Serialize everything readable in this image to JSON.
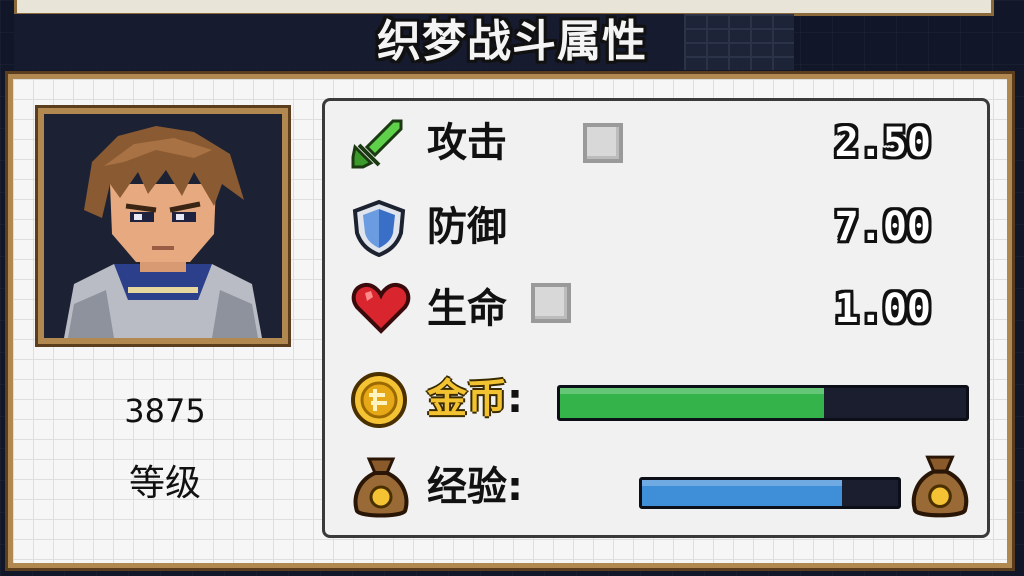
{
  "title": "织梦战斗属性",
  "portrait": {
    "icon": "hero-portrait"
  },
  "level": {
    "value": "3875",
    "label": "等级"
  },
  "stats": [
    {
      "key": "attack",
      "label": "攻击",
      "value": "2.50",
      "icon": "sword-icon",
      "has_checkbox": true
    },
    {
      "key": "defense",
      "label": "防御",
      "value": "7.00",
      "icon": "shield-icon",
      "has_checkbox": false
    },
    {
      "key": "health",
      "label": "生命",
      "value": "1.00",
      "icon": "heart-icon",
      "has_checkbox": true
    }
  ],
  "bars": {
    "gold": {
      "label": "金币",
      "separator": ":",
      "fill_fraction": 0.65,
      "color": "#33b34a",
      "icon": "gold-coin-icon"
    },
    "exp": {
      "label": "经验",
      "separator": ":",
      "fill_fraction": 0.78,
      "color": "#3f8fd8",
      "icon": "money-bag-icon"
    }
  },
  "colors": {
    "frame": "#b08850",
    "frame_dark": "#5a3e1e",
    "panel": "#f6f6f6"
  }
}
